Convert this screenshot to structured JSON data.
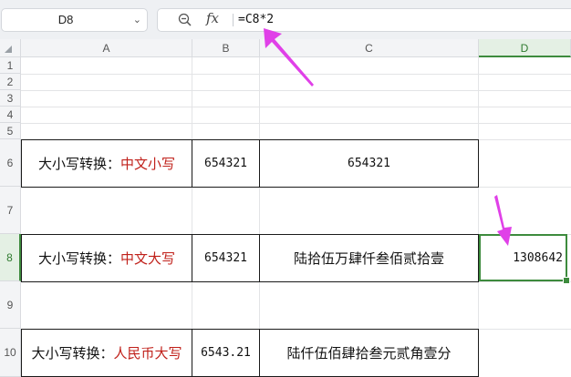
{
  "name_box": {
    "value": "D8"
  },
  "formula_bar": {
    "formula": "=C8*2",
    "fx_label": "fx"
  },
  "columns": [
    "A",
    "B",
    "C",
    "D"
  ],
  "rows": [
    "1",
    "2",
    "3",
    "4",
    "5",
    "6",
    "7",
    "8",
    "9",
    "10"
  ],
  "table": {
    "row6": {
      "prefix": "大小写转换：",
      "highlight": "中文小写",
      "b": "654321",
      "c": "654321"
    },
    "row8": {
      "prefix": "大小写转换：",
      "highlight": "中文大写",
      "b": "654321",
      "c": "陆拾伍万肆仟叁佰贰拾壹",
      "d": "1308642"
    },
    "row10": {
      "prefix": "大小写转换：",
      "highlight": "人民币大写",
      "b": "6543.21",
      "c": "陆仟伍佰肆拾叁元贰角壹分"
    }
  },
  "colors": {
    "highlight": "#c0201a",
    "selection": "#3d8b3d",
    "annotation_arrow": "#e040e8"
  },
  "icons": [
    "zoom-icon",
    "fx-icon",
    "chevron-down-icon",
    "select-all-corner-icon"
  ]
}
